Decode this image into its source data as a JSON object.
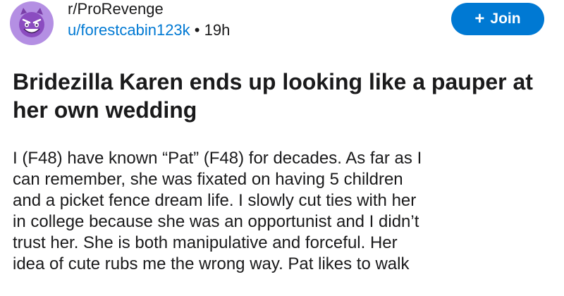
{
  "post": {
    "subreddit": "r/ProRevenge",
    "username": "u/forestcabin123k",
    "separator": "•",
    "time": "19h",
    "join_label": "Join",
    "join_icon": "plus-icon",
    "avatar_icon": "smiling-devil-icon",
    "title": "Bridezilla Karen ends up looking like a pauper at her own wedding",
    "body_lines": [
      "I  (F48) have known “Pat” (F48) for decades. As far as I",
      "can remember, she was fixated on having 5 children",
      "and a picket fence dream life. I slowly cut ties with her",
      "in college because she was an opportunist and I didn’t",
      "trust her. She is both manipulative and forceful. Her",
      "idea of cute rubs me the wrong way. Pat likes to walk"
    ]
  },
  "colors": {
    "brand_blue": "#0079d3",
    "avatar_purple": "#b48fe3",
    "text": "#1a1a1b"
  }
}
